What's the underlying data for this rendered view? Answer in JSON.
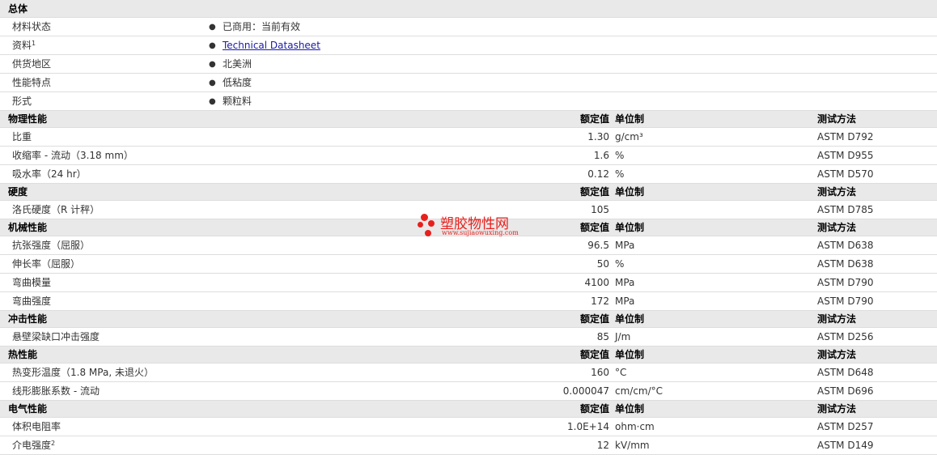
{
  "general": {
    "title": "总体",
    "rows": [
      {
        "label": "材料状态",
        "sup": "",
        "value": "已商用：当前有效",
        "link": false
      },
      {
        "label": "资料",
        "sup": "1",
        "value": "Technical Datasheet",
        "link": true
      },
      {
        "label": "供货地区",
        "sup": "",
        "value": "北美洲",
        "link": false
      },
      {
        "label": "性能特点",
        "sup": "",
        "value": "低粘度",
        "link": false
      },
      {
        "label": "形式",
        "sup": "",
        "value": "颗粒料",
        "link": false
      }
    ]
  },
  "column_headers": {
    "value": "额定值",
    "unit": "单位制",
    "method": "测试方法"
  },
  "sections": [
    {
      "title": "物理性能",
      "rows": [
        {
          "label": "比重",
          "cond": "",
          "sup": "",
          "value": "1.30",
          "unit": "g/cm³",
          "method": "ASTM D792"
        },
        {
          "label": "收缩率",
          "cond": " - 流动（3.18 mm）",
          "sup": "",
          "value": "1.6",
          "unit": "%",
          "method": "ASTM D955"
        },
        {
          "label": "吸水率",
          "cond": "（24 hr）",
          "sup": "",
          "value": "0.12",
          "unit": "%",
          "method": "ASTM D570"
        }
      ]
    },
    {
      "title": "硬度",
      "rows": [
        {
          "label": "洛氏硬度",
          "cond": "（R 计秤）",
          "sup": "",
          "value": "105",
          "unit": "",
          "method": "ASTM D785"
        }
      ]
    },
    {
      "title": "机械性能",
      "rows": [
        {
          "label": "抗张强度",
          "cond": "（屈服）",
          "sup": "",
          "value": "96.5",
          "unit": "MPa",
          "method": "ASTM D638"
        },
        {
          "label": "伸长率",
          "cond": "（屈服）",
          "sup": "",
          "value": "50",
          "unit": "%",
          "method": "ASTM D638"
        },
        {
          "label": "弯曲模量",
          "cond": "",
          "sup": "",
          "value": "4100",
          "unit": "MPa",
          "method": "ASTM D790"
        },
        {
          "label": "弯曲强度",
          "cond": "",
          "sup": "",
          "value": "172",
          "unit": "MPa",
          "method": "ASTM D790"
        }
      ]
    },
    {
      "title": "冲击性能",
      "rows": [
        {
          "label": "悬壁梁缺口冲击强度",
          "cond": "",
          "sup": "",
          "value": "85",
          "unit": "J/m",
          "method": "ASTM D256"
        }
      ]
    },
    {
      "title": "热性能",
      "rows": [
        {
          "label": "热变形温度",
          "cond": "（1.8 MPa, 未退火）",
          "sup": "",
          "value": "160",
          "unit": "°C",
          "method": "ASTM D648"
        },
        {
          "label": "线形膨胀系数",
          "cond": " - 流动",
          "sup": "",
          "value": "0.000047",
          "unit": "cm/cm/°C",
          "method": "ASTM D696"
        }
      ]
    },
    {
      "title": "电气性能",
      "rows": [
        {
          "label": "体积电阻率",
          "cond": "",
          "sup": "",
          "value": "1.0E+14",
          "unit": "ohm·cm",
          "method": "ASTM D257"
        },
        {
          "label": "介电强度",
          "cond": "",
          "sup": "2",
          "value": "12",
          "unit": "kV/mm",
          "method": "ASTM D149"
        }
      ]
    }
  ],
  "watermark": {
    "name": "塑胶物性网",
    "url": "www.sujiaowuxing.com",
    "color": "#e8201c"
  }
}
